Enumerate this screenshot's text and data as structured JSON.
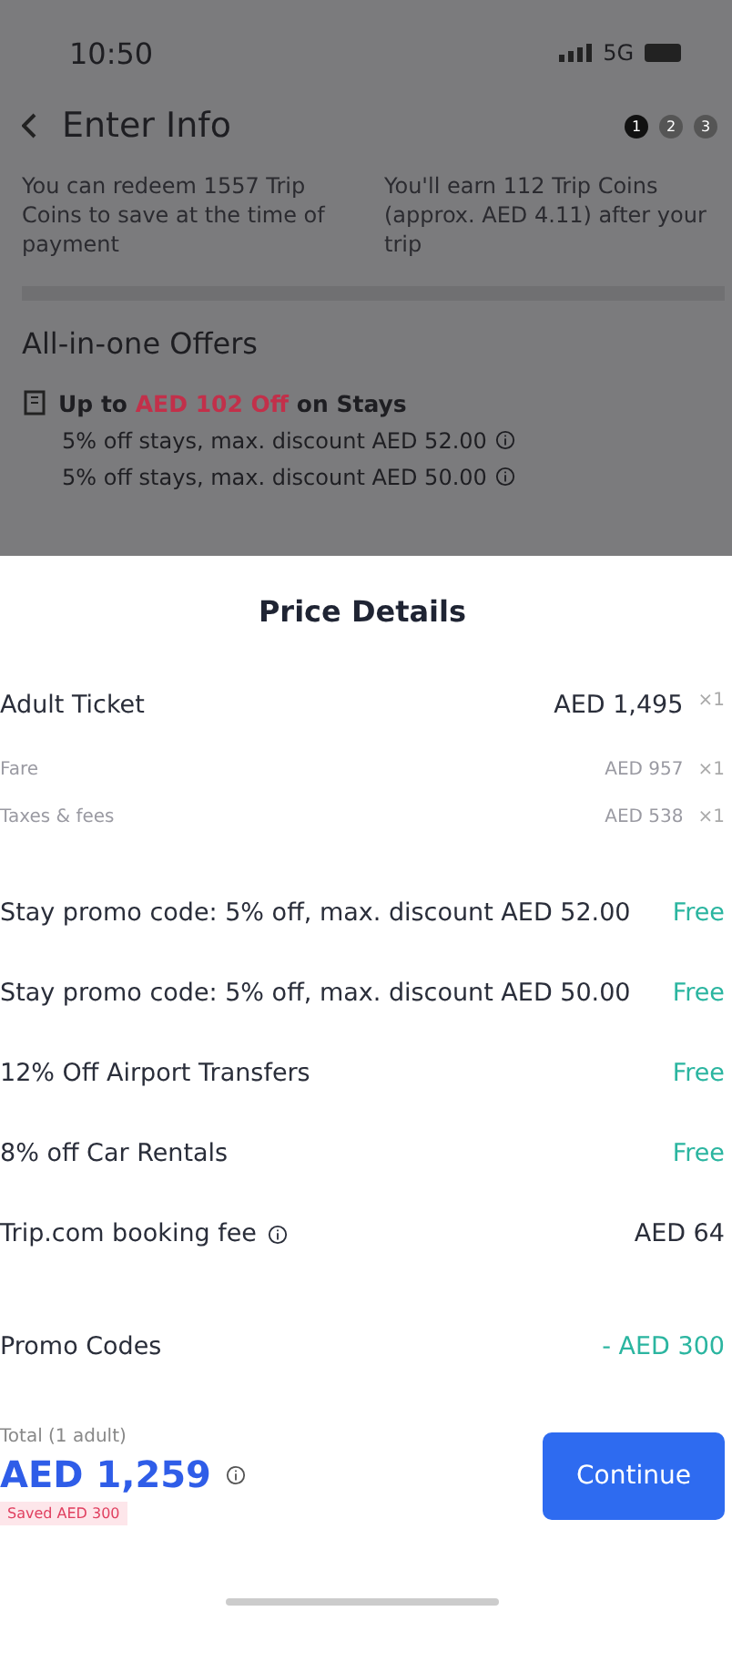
{
  "status_bar": {
    "time": "10:50",
    "network": "5G"
  },
  "header": {
    "title": "Enter Info",
    "steps": [
      {
        "label": "1",
        "selected": true
      },
      {
        "label": "2",
        "selected": false
      },
      {
        "label": "3",
        "selected": false
      }
    ]
  },
  "coins": [
    "You can redeem 1557 Trip Coins to save at the time of payment",
    "You'll earn 112 Trip Coins (approx. AED 4.11) after your trip"
  ],
  "offers": {
    "title": "All-in-one Offers",
    "headline": {
      "prefix": "Up to",
      "highlight": "AED 102 Off",
      "suffix": "on Stays"
    },
    "items": [
      "5% off stays, max. discount AED 52.00",
      "5% off stays, max. discount AED 50.00"
    ]
  },
  "sheet": {
    "title": "Price Details",
    "rows": [
      {
        "kind": "main",
        "label": "Adult Ticket",
        "value": "AED 1,495",
        "count": "×1"
      },
      {
        "kind": "sub",
        "label": "Fare",
        "value": "AED 957",
        "count": "×1"
      },
      {
        "kind": "sub",
        "label": "Taxes & fees",
        "value": "AED 538",
        "count": "×1"
      },
      {
        "kind": "promo",
        "label": "Stay promo code: 5% off, max. discount AED 52.00",
        "value": "Free"
      },
      {
        "kind": "promo",
        "label": "Stay promo code: 5% off, max. discount AED 50.00",
        "value": "Free"
      },
      {
        "kind": "promo",
        "label": "12% Off Airport Transfers",
        "value": "Free"
      },
      {
        "kind": "promo",
        "label": "8% off Car Rentals",
        "value": "Free"
      },
      {
        "kind": "fee",
        "label": "Trip.com booking fee",
        "value": "AED 64"
      },
      {
        "kind": "discount",
        "label": "Promo Codes",
        "value": "- AED 300"
      }
    ]
  },
  "footer": {
    "total_label": "Total (1 adult)",
    "amount": "AED 1,259",
    "saved": "Saved AED 300",
    "button": "Continue"
  }
}
